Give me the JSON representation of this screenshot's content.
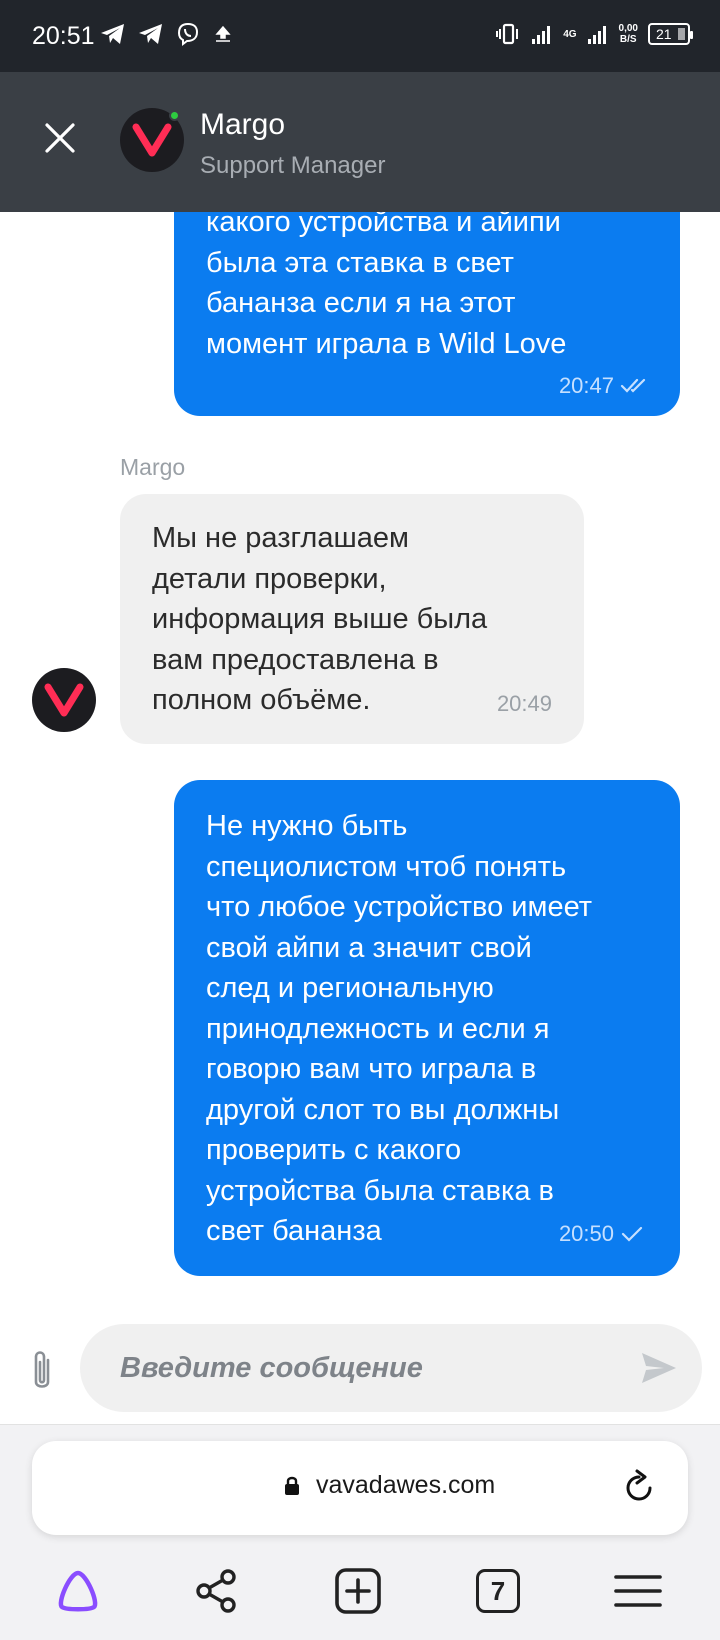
{
  "status_bar": {
    "time": "20:51",
    "network": "4G",
    "speed_value": "0,00",
    "speed_unit": "B/S",
    "battery": "21",
    "icons": [
      "telegram-icon",
      "telegram-icon",
      "viber-icon",
      "upload-icon",
      "vibrate-icon",
      "signal-icon",
      "signal-icon"
    ]
  },
  "header": {
    "contact_name": "Margo",
    "contact_role": "Support Manager",
    "online": true,
    "icons": [
      "close-icon",
      "avatar-logo-icon"
    ]
  },
  "messages": [
    {
      "direction": "outgoing",
      "lines": [
        "какого устройства и айипи",
        "была эта ставка в свет",
        "бананза если я на этот",
        "момент играла в Wild Love"
      ],
      "time": "20:47",
      "status": "read"
    },
    {
      "direction": "incoming",
      "sender": "Margo",
      "lines": [
        "Мы не разглашаем",
        "детали проверки,",
        "информация выше была",
        "вам предоставлена в",
        "полном объёме."
      ],
      "time": "20:49"
    },
    {
      "direction": "outgoing",
      "lines": [
        "Не нужно быть",
        "специолистом чтоб понять",
        "что любое устройство имеет",
        "свой айпи а значит свой",
        "след и региональную",
        "принодлежность и если я",
        "говорю вам что играла в",
        "другой слот то вы должны",
        "проверить с какого",
        "устройства была ставка в",
        "свет бананза"
      ],
      "time": "20:50",
      "status": "sent"
    }
  ],
  "composer": {
    "placeholder": "Введите сообщение",
    "value": ""
  },
  "browser": {
    "url": "vavadawes.com",
    "tabs_count": "7",
    "accent_color": "#8a4dff"
  },
  "colors": {
    "outgoing_bubble": "#0b7cf0",
    "incoming_bubble": "#f0f0f0",
    "header_bg": "#3a3f45",
    "brand_red": "#ff2d55"
  }
}
